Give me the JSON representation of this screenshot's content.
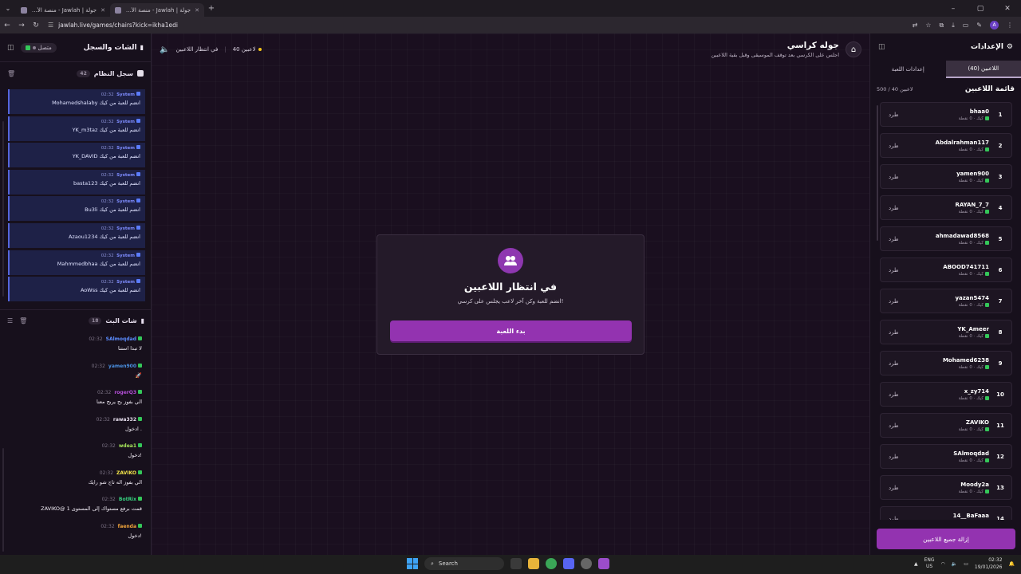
{
  "browser": {
    "tabs": [
      {
        "title": "جولة | Jawlah - منصة الألعاب الت..."
      },
      {
        "title": "جولة | Jawlah - منصة الألعاب الت..."
      }
    ],
    "url": "jawlah.live/games/chairs?kick=ikha1edi"
  },
  "left_panel": {
    "title": "الشات والسجل",
    "online_label": "متصل",
    "system_log": {
      "title": "سجل النظام",
      "count": "42",
      "messages": [
        {
          "sender": "System",
          "time": "02:32",
          "text": "Mohamedshalaby انضم للعبة من كيك"
        },
        {
          "sender": "System",
          "time": "02:32",
          "text": "YK_m3taz انضم للعبة من كيك"
        },
        {
          "sender": "System",
          "time": "02:32",
          "text": "YK_DAVID انضم للعبة من كيك"
        },
        {
          "sender": "System",
          "time": "02:32",
          "text": "basta123 انضم للعبة من كيك"
        },
        {
          "sender": "System",
          "time": "02:32",
          "text": "Bu3li انضم للعبة من كيك"
        },
        {
          "sender": "System",
          "time": "02:32",
          "text": "Azaou1234 انضم للعبة من كيك"
        },
        {
          "sender": "System",
          "time": "02:32",
          "text": "Mahmmedbhaa انضم للعبة من كيك"
        },
        {
          "sender": "System",
          "time": "02:32",
          "text": "AoWss انضم للعبة من كيك"
        }
      ]
    },
    "live_chat": {
      "title": "شات البث",
      "count": "18",
      "messages": [
        {
          "user": "SAlmoqdad",
          "color": "#5b8cff",
          "time": "02:32",
          "text": "لا تبدا استنا"
        },
        {
          "user": "yamen900",
          "color": "#4a90e2",
          "time": "02:32",
          "text": "🚀"
        },
        {
          "user": "rogerQ3",
          "color": "#b44fd8",
          "time": "02:32",
          "text": "الي بفوز بح يربح معنا"
        },
        {
          "user": "rawa332",
          "color": "#e8e0ef",
          "time": "02:32",
          "text": "ادخول ."
        },
        {
          "user": "wdea1",
          "color": "#a6e35a",
          "time": "02:32",
          "text": "دخول!"
        },
        {
          "user": "ZAVIKO",
          "color": "#f0e24a",
          "time": "02:32",
          "text": "الي بفوز اله تاج شو رايك"
        },
        {
          "user": "BotRix",
          "color": "#35d07f",
          "time": "02:32",
          "text": "ZAVIKO@ قمت برفع مستواك إلى المستوى 1"
        },
        {
          "user": "faenda",
          "color": "#f2a53b",
          "time": "02:32",
          "text": "دخول!"
        }
      ]
    }
  },
  "topbar": {
    "game_title": "جوله كراسي",
    "game_subtitle": "اجلس على الكرسي بعد توقف الموسيقى وقبل بقية اللاعبين",
    "status": "في انتظار اللاعبين",
    "players_count": "40 لاعبين"
  },
  "wait_card": {
    "title": "في انتظار اللاعبين",
    "subtitle": "انضم للعبة وكن آخر لاعب يجلس على كرسي!",
    "start_button": "بدء اللعبة"
  },
  "right_panel": {
    "title": "الإعدادات",
    "tabs": [
      {
        "label": "اللاعبين (40)"
      },
      {
        "label": "إعدادات اللعبة"
      }
    ],
    "list_title": "قائمة اللاعبين",
    "list_count": "500 / 40 لاعبين",
    "kick_label": "طرد",
    "meta_label": "كيك · 0 نقطة",
    "players": [
      {
        "num": "1",
        "name": "bhaa0"
      },
      {
        "num": "2",
        "name": "Abdalrahman117"
      },
      {
        "num": "3",
        "name": "yamen900"
      },
      {
        "num": "4",
        "name": "RAYAN_7_7"
      },
      {
        "num": "5",
        "name": "ahmadawad8568"
      },
      {
        "num": "6",
        "name": "ABOOD741711"
      },
      {
        "num": "7",
        "name": "yazan5474"
      },
      {
        "num": "8",
        "name": "YK_Ameer"
      },
      {
        "num": "9",
        "name": "Mohamed6238"
      },
      {
        "num": "10",
        "name": "x_zy714"
      },
      {
        "num": "11",
        "name": "ZAVIKO"
      },
      {
        "num": "12",
        "name": "SAlmoqdad"
      },
      {
        "num": "13",
        "name": "Moody2a"
      },
      {
        "num": "14",
        "name": "14__BaFaaa"
      }
    ],
    "remove_all": "إزالة جميع اللاعبين"
  },
  "taskbar": {
    "search": "Search",
    "lang_top": "ENG",
    "lang_bottom": "US",
    "time": "02:32",
    "date": "19/01/2026"
  }
}
